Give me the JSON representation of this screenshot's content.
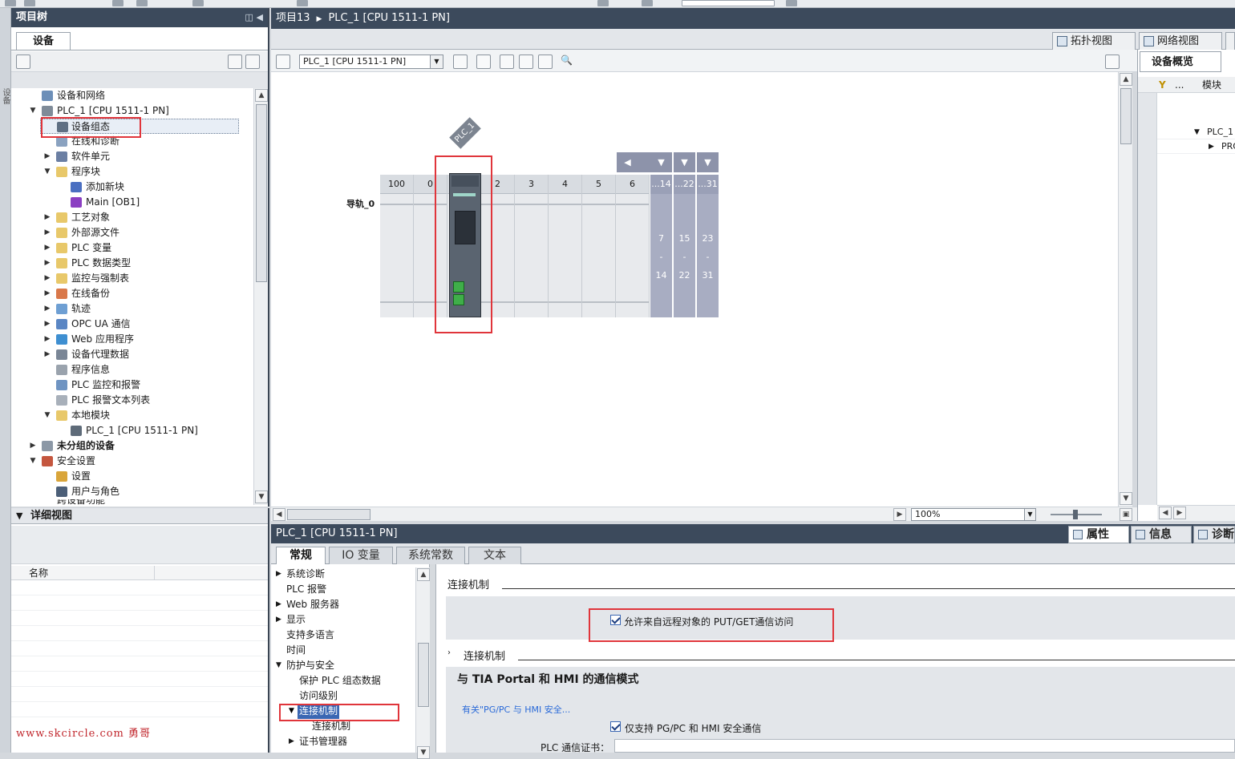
{
  "project_tree": {
    "title": "项目树",
    "tab": "设备",
    "items": [
      {
        "label": "设备和网络"
      },
      {
        "label": "PLC_1 [CPU 1511-1 PN]"
      },
      {
        "label": "设备组态"
      },
      {
        "label": "在线和诊断"
      },
      {
        "label": "软件单元"
      },
      {
        "label": "程序块"
      },
      {
        "label": "添加新块"
      },
      {
        "label": "Main [OB1]"
      },
      {
        "label": "工艺对象"
      },
      {
        "label": "外部源文件"
      },
      {
        "label": "PLC 变量"
      },
      {
        "label": "PLC 数据类型"
      },
      {
        "label": "监控与强制表"
      },
      {
        "label": "在线备份"
      },
      {
        "label": "轨迹"
      },
      {
        "label": "OPC UA 通信"
      },
      {
        "label": "Web 应用程序"
      },
      {
        "label": "设备代理数据"
      },
      {
        "label": "程序信息"
      },
      {
        "label": "PLC 监控和报警"
      },
      {
        "label": "PLC 报警文本列表"
      },
      {
        "label": "本地模块"
      },
      {
        "label": "PLC_1 [CPU 1511-1 PN]"
      },
      {
        "label": "未分组的设备"
      },
      {
        "label": "安全设置"
      },
      {
        "label": "设置"
      },
      {
        "label": "用户与角色"
      },
      {
        "label": "跨设备功能"
      }
    ]
  },
  "details_view": {
    "title": "详细视图",
    "column_name": "名称"
  },
  "watermark": "www.skcircle.com 勇哥",
  "editor": {
    "breadcrumb": [
      "项目13",
      "PLC_1 [CPU 1511-1 PN]"
    ],
    "view_tabs": {
      "topology": "拓扑视图",
      "network": "网络视图"
    },
    "device_select": "PLC_1 [CPU 1511-1 PN]",
    "device_tag": "PLC_1",
    "rail_label": "导轨_0",
    "slots": [
      "100",
      "0",
      "1",
      "2",
      "3",
      "4",
      "5",
      "6"
    ],
    "ext_slots": [
      "...14",
      "...22",
      "...31"
    ],
    "ext_ranges": [
      {
        "from": "7",
        "dash": "-",
        "to": "14"
      },
      {
        "from": "15",
        "dash": "-",
        "to": "22"
      },
      {
        "from": "23",
        "dash": "-",
        "to": "31"
      }
    ],
    "zoom": "100%"
  },
  "device_overview": {
    "title": "设备概览",
    "col_dots": "...",
    "col_module": "模块",
    "rows": [
      "PLC_1",
      "PRO"
    ]
  },
  "properties": {
    "title": "PLC_1 [CPU 1511-1 PN]",
    "panel_tabs": {
      "properties": "属性",
      "info": "信息",
      "diagnostics": "诊断"
    },
    "tabs": [
      "常规",
      "IO 变量",
      "系统常数",
      "文本"
    ],
    "nav": [
      "系统诊断",
      "PLC 报警",
      "Web 服务器",
      "显示",
      "支持多语言",
      "时间",
      "防护与安全",
      "保护 PLC 组态数据",
      "访问级别",
      "连接机制",
      "连接机制",
      "证书管理器"
    ],
    "section1": "连接机制",
    "checkbox1": "允许来自远程对象的 PUT/GET通信访问",
    "section2": "连接机制",
    "section3": "与 TIA Portal 和 HMI 的通信模式",
    "link": "有关\"PG/PC 与 HMI 安全...",
    "checkbox2": "仅支持 PG/PC 和 HMI 安全通信",
    "cert_label": "PLC 通信证书："
  }
}
